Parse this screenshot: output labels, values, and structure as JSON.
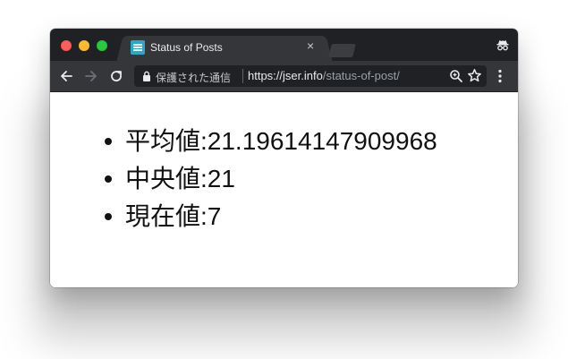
{
  "window": {
    "tab_title": "Status of Posts",
    "tab_close": "×",
    "secure_label": "保護された通信",
    "url_scheme": "https://",
    "url_host": "jser.info",
    "url_path": "/status-of-post/"
  },
  "icons": {
    "back": "arrow-left-icon",
    "forward": "arrow-right-icon",
    "reload": "reload-icon",
    "lock": "lock-icon",
    "zoom": "zoom-icon",
    "star": "star-icon",
    "menu": "more-vert-icon",
    "incognito": "incognito-icon",
    "favicon": "favicon-icon"
  },
  "colors": {
    "tabstrip": "#202124",
    "toolbar": "#35363a",
    "favicon": "#2aa9c5"
  },
  "stats": [
    {
      "label": "平均値",
      "value": "21.19614147909968",
      "text": "平均値:21.19614147909968"
    },
    {
      "label": "中央値",
      "value": "21",
      "text": "中央値:21"
    },
    {
      "label": "現在値",
      "value": "7",
      "text": "現在値:7"
    }
  ]
}
